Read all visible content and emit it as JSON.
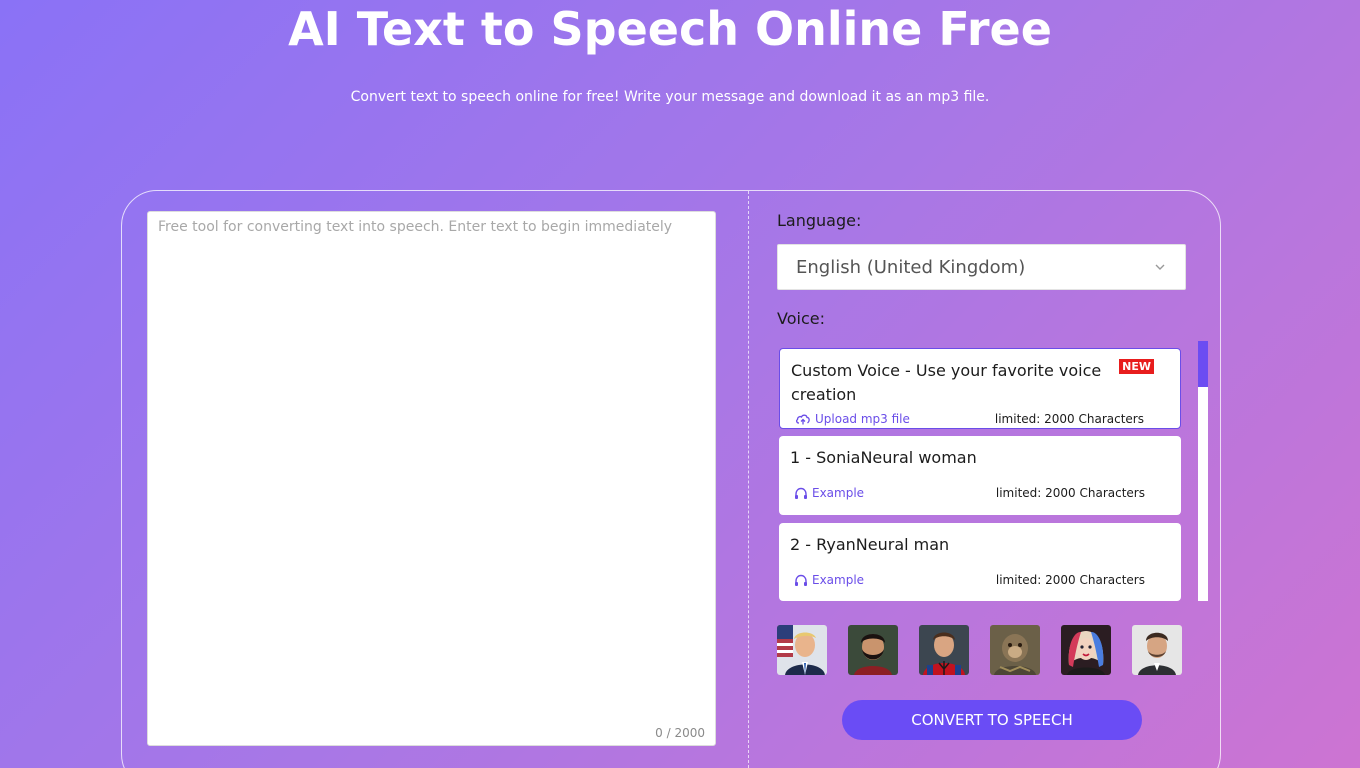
{
  "hero": {
    "title": "AI Text to Speech Online Free",
    "subtitle": "Convert text to speech online for free! Write your message and download it as an mp3 file."
  },
  "editor": {
    "placeholder": "Free tool for converting text into speech. Enter text to begin immediately",
    "char_count": "0 / 2000"
  },
  "language": {
    "label": "Language:",
    "selected": "English (United Kingdom)",
    "icon": "chevron-down-icon"
  },
  "voice": {
    "label": "Voice:",
    "items": [
      {
        "name": "Custom Voice - Use your favorite voice creation",
        "badge": "NEW",
        "link_label": "Upload mp3 file",
        "link_icon": "cloud-upload-icon",
        "limit": "limited: 2000 Characters",
        "selected": true
      },
      {
        "name": "1 - SoniaNeural woman",
        "link_label": "Example",
        "link_icon": "headphones-icon",
        "limit": "limited: 2000 Characters",
        "selected": false
      },
      {
        "name": "2 - RyanNeural man",
        "link_label": "Example",
        "link_icon": "headphones-icon",
        "limit": "limited: 2000 Characters",
        "selected": false
      }
    ]
  },
  "avatars": [
    {
      "name": "avatar-man-suit-flag"
    },
    {
      "name": "avatar-bearded-man"
    },
    {
      "name": "avatar-spider-hero"
    },
    {
      "name": "avatar-monkey-warrior"
    },
    {
      "name": "avatar-harley-character"
    },
    {
      "name": "avatar-man-dark-suit"
    }
  ],
  "colors": {
    "accent": "#6a4cf5",
    "badge": "#e81d1d",
    "gradient_start": "#8a72f6",
    "gradient_end": "#cd74d2"
  },
  "actions": {
    "convert_label": "CONVERT TO SPEECH"
  }
}
